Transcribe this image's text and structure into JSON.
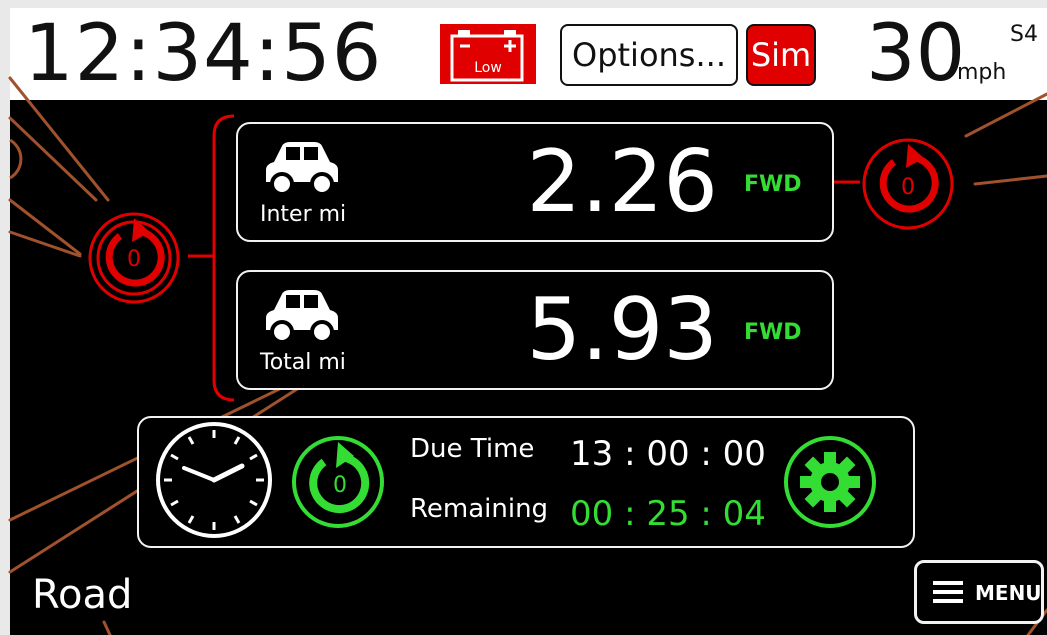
{
  "status_bar": {
    "clock": "12:34:56",
    "battery_label": "Low",
    "options_label": "Options...",
    "sim_label": "Sim",
    "speed": "30",
    "speed_unit": "mph",
    "speed_sub": "S4"
  },
  "odometers": [
    {
      "label": "Inter mi",
      "value": "2.26",
      "direction": "FWD"
    },
    {
      "label": "Total mi",
      "value": "5.93",
      "direction": "FWD"
    }
  ],
  "reset_buttons": {
    "left_count": "0",
    "right_count": "0",
    "timer_count": "0"
  },
  "timer": {
    "due_label": "Due Time",
    "due_value": "13 : 00 : 00",
    "remaining_label": "Remaining",
    "remaining_value": "00 : 25 : 04"
  },
  "footer": {
    "mode": "Road",
    "menu_label": "MENU"
  },
  "colors": {
    "accent_red": "#e00000",
    "accent_green": "#33dd33",
    "screen_bg": "#000000",
    "callout_brown": "#a0522d"
  },
  "icons": [
    "battery-icon",
    "car-icon",
    "reset-icon",
    "clock-icon",
    "gear-icon",
    "hamburger-icon"
  ]
}
